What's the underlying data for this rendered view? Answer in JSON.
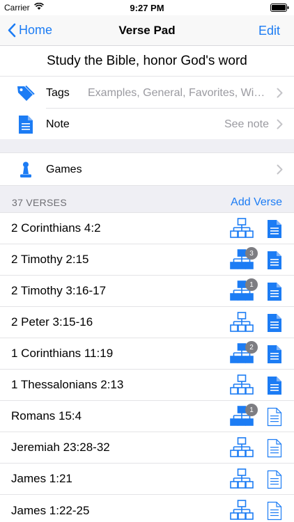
{
  "status": {
    "carrier": "Carrier",
    "time": "9:27 PM"
  },
  "nav": {
    "back_label": "Home",
    "title": "Verse Pad",
    "edit_label": "Edit"
  },
  "heading": "Study the Bible, honor God's word",
  "tags": {
    "label": "Tags",
    "value": "Examples, General, Favorites, Wisd..."
  },
  "note": {
    "label": "Note",
    "value": "See note"
  },
  "games": {
    "label": "Games"
  },
  "section": {
    "count_label": "37 VERSES",
    "add_label": "Add Verse"
  },
  "colors": {
    "accent": "#1c7cf4",
    "badge": "#7d7d82",
    "group_bg": "#efeff4"
  },
  "verses": [
    {
      "ref": "2 Corinthians 4:2",
      "tree_filled": false,
      "badge": "",
      "note_filled": true
    },
    {
      "ref": "2 Timothy 2:15",
      "tree_filled": true,
      "badge": "3",
      "note_filled": true
    },
    {
      "ref": "2 Timothy 3:16-17",
      "tree_filled": true,
      "badge": "1",
      "note_filled": true
    },
    {
      "ref": "2 Peter 3:15-16",
      "tree_filled": false,
      "badge": "",
      "note_filled": true
    },
    {
      "ref": "1 Corinthians 11:19",
      "tree_filled": true,
      "badge": "2",
      "note_filled": true
    },
    {
      "ref": "1 Thessalonians 2:13",
      "tree_filled": false,
      "badge": "",
      "note_filled": true
    },
    {
      "ref": "Romans 15:4",
      "tree_filled": true,
      "badge": "1",
      "note_filled": false
    },
    {
      "ref": "Jeremiah 23:28-32",
      "tree_filled": false,
      "badge": "",
      "note_filled": false
    },
    {
      "ref": "James 1:21",
      "tree_filled": false,
      "badge": "",
      "note_filled": false
    },
    {
      "ref": "James 1:22-25",
      "tree_filled": false,
      "badge": "",
      "note_filled": false
    }
  ]
}
